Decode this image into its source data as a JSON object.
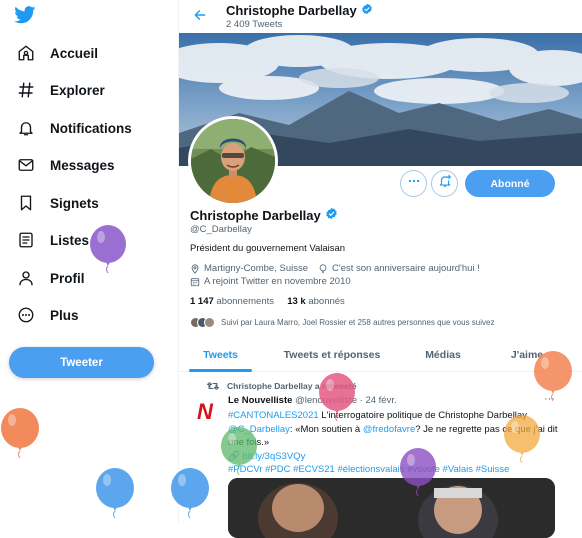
{
  "nav": {
    "items": [
      {
        "label": "Accueil",
        "icon": "home-icon"
      },
      {
        "label": "Explorer",
        "icon": "hashtag-icon"
      },
      {
        "label": "Notifications",
        "icon": "bell-icon"
      },
      {
        "label": "Messages",
        "icon": "envelope-icon"
      },
      {
        "label": "Signets",
        "icon": "bookmark-icon"
      },
      {
        "label": "Listes",
        "icon": "list-icon"
      },
      {
        "label": "Profil",
        "icon": "person-icon"
      },
      {
        "label": "Plus",
        "icon": "more-circle-icon"
      }
    ],
    "tweet_button": "Tweeter"
  },
  "header": {
    "name": "Christophe Darbellay",
    "tweet_count": "2 409 Tweets"
  },
  "profile": {
    "name": "Christophe Darbellay",
    "handle": "@C_Darbellay",
    "bio": "Président du gouvernement Valaisan",
    "location": "Martigny-Combe, Suisse",
    "birthday": "C'est son anniversaire aujourd'hui !",
    "joined": "A rejoint Twitter en novembre 2010",
    "following_count": "1 147",
    "following_label": "abonnements",
    "followers_count": "13 k",
    "followers_label": "abonnés",
    "followed_by": "Suivi par Laura Marro, Joel Rossier et 258 autres personnes que vous suivez",
    "follow_button": "Abonné"
  },
  "tabs": [
    {
      "label": "Tweets",
      "active": true
    },
    {
      "label": "Tweets et réponses",
      "active": false
    },
    {
      "label": "Médias",
      "active": false
    },
    {
      "label": "J'aime",
      "active": false
    }
  ],
  "tweet": {
    "retweet_line": "Christophe Darbellay a retweeté",
    "author": "Le Nouvelliste",
    "handle": "@lenouvelliste",
    "date": "· 24 févr.",
    "more": "···",
    "avatar_letter": "N",
    "body": {
      "hashtag1": "#CANTONALES2021",
      "text1": " L'interrogatoire politique de Christophe Darbellay ",
      "mention1": "@C_Darbellay",
      "text2": ": «Mon soutien à ",
      "mention2": "@fredofavre",
      "text3": "? Je ne regrette pas ce que j'ai dit une fois.»",
      "link": "bit.ly/3qS3VQy",
      "hashtags2": "#PDCVr #PDC #ECVS21 #électionsvalais #vsvote #Valais #Suisse"
    }
  },
  "colors": {
    "accent": "#1d9bf0",
    "button": "#4a9ff0",
    "balloon_purple": "#9b6fd1",
    "balloon_orange": "#f38a5c",
    "balloon_blue": "#5ba6ec",
    "balloon_pink": "#e55a84",
    "balloon_green": "#5bb96a",
    "balloon_yellow": "#f4a940"
  }
}
